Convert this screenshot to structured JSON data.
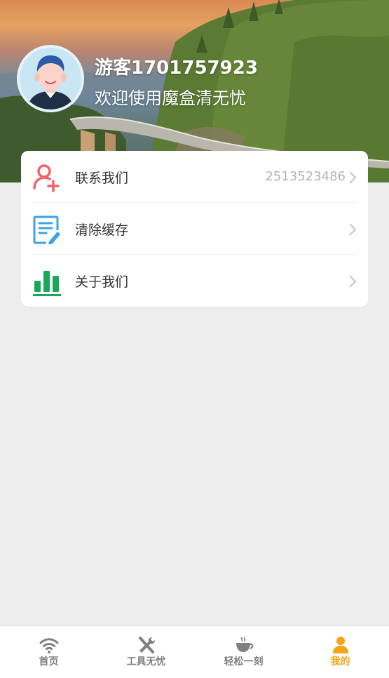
{
  "profile": {
    "username": "游客1701757923",
    "welcome": "欢迎使用魔盒清无忧"
  },
  "menu": {
    "items": [
      {
        "label": "联系我们",
        "value": "2513523486",
        "icon": "add-user-icon"
      },
      {
        "label": "清除缓存",
        "value": "",
        "icon": "edit-document-icon"
      },
      {
        "label": "关于我们",
        "value": "",
        "icon": "bar-chart-icon"
      }
    ]
  },
  "tabbar": {
    "tabs": [
      {
        "label": "首页",
        "icon": "wifi-icon",
        "active": false
      },
      {
        "label": "工具无忧",
        "icon": "tools-icon",
        "active": false
      },
      {
        "label": "轻松一刻",
        "icon": "coffee-cup-icon",
        "active": false
      },
      {
        "label": "我的",
        "icon": "person-icon",
        "active": true
      }
    ]
  },
  "colors": {
    "accent": "#f5a416",
    "contact_icon": "#f0636a",
    "cache_icon": "#3ea3e6",
    "about_icon": "#19a85a",
    "background": "#ededed"
  }
}
